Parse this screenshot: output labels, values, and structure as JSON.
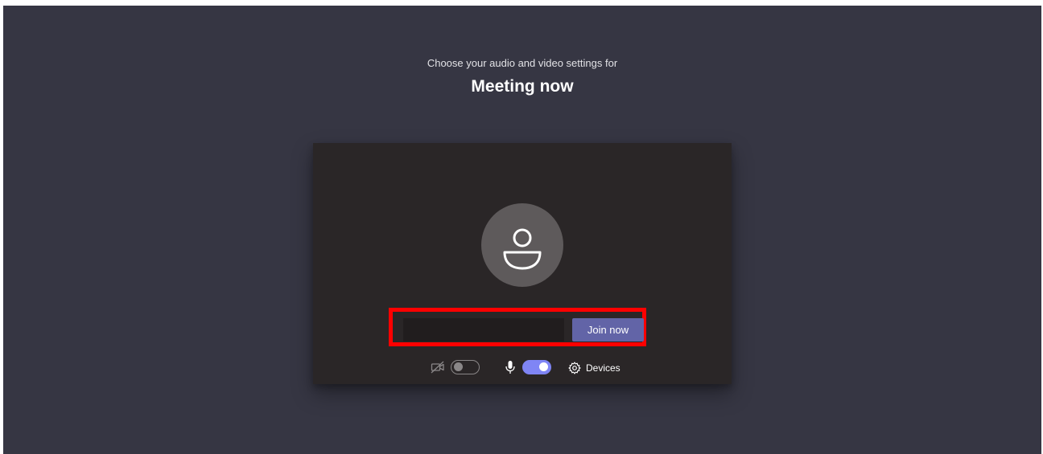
{
  "header": {
    "subtitle": "Choose your audio and video settings for",
    "meeting_title": "Meeting now"
  },
  "join": {
    "name_value": "",
    "button_label": "Join now"
  },
  "controls": {
    "camera_on": false,
    "microphone_on": true,
    "devices_label": "Devices"
  },
  "colors": {
    "background": "#363643",
    "preview": "#2a2627",
    "accent": "#6264a7",
    "toggle_on": "#7f85f5",
    "highlight": "#ff0000"
  },
  "icons": {
    "avatar": "person-icon",
    "camera": "camera-off-icon",
    "microphone": "microphone-icon",
    "devices": "gear-icon"
  }
}
